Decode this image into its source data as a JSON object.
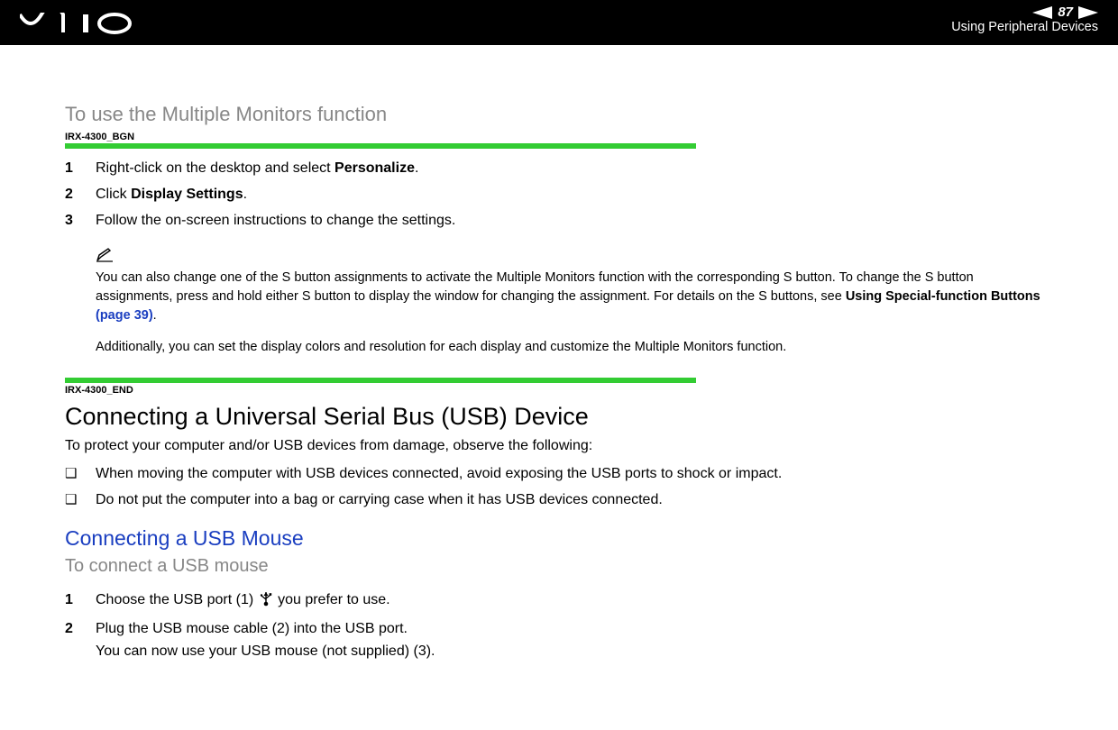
{
  "header": {
    "page_number": "87",
    "n_label": "n  N",
    "subtitle": "Using Peripheral Devices"
  },
  "sec1": {
    "title": "To use the Multiple Monitors function",
    "tag_begin": "IRX-4300_BGN",
    "tag_end": "IRX-4300_END",
    "steps": [
      {
        "n": "1",
        "pre": "Right-click on the desktop and select ",
        "bold": "Personalize",
        "post": "."
      },
      {
        "n": "2",
        "pre": "Click ",
        "bold": "Display Settings",
        "post": "."
      },
      {
        "n": "3",
        "pre": "Follow the on-screen instructions to change the settings.",
        "bold": "",
        "post": ""
      }
    ],
    "note_a": "You can also change one of the S button assignments to activate the Multiple Monitors function with the corresponding S button. To change the S button assignments, press and hold either S button to display the window for changing the assignment. For details on the S buttons, see ",
    "note_bold": "Using Special-function Buttons ",
    "note_link": "(page 39)",
    "note_post": ".",
    "additional": "Additionally, you can set the display colors and resolution for each display and customize the Multiple Monitors function."
  },
  "sec2": {
    "title": "Connecting a Universal Serial Bus (USB) Device",
    "intro": "To protect your computer and/or USB devices from damage, observe the following:",
    "bullets": [
      "When moving the computer with USB devices connected, avoid exposing the USB ports to shock or impact.",
      "Do not put the computer into a bag or carrying case when it has USB devices connected."
    ]
  },
  "sec3": {
    "title": "Connecting a USB Mouse",
    "subtitle": "To connect a USB mouse",
    "steps": [
      {
        "n": "1",
        "pre": "Choose the USB port (1) ",
        "icon": "usb",
        "post": " you prefer to use."
      },
      {
        "n": "2",
        "line1": "Plug the USB mouse cable (2) into the USB port.",
        "line2": "You can now use your USB mouse (not supplied) (3)."
      }
    ]
  }
}
